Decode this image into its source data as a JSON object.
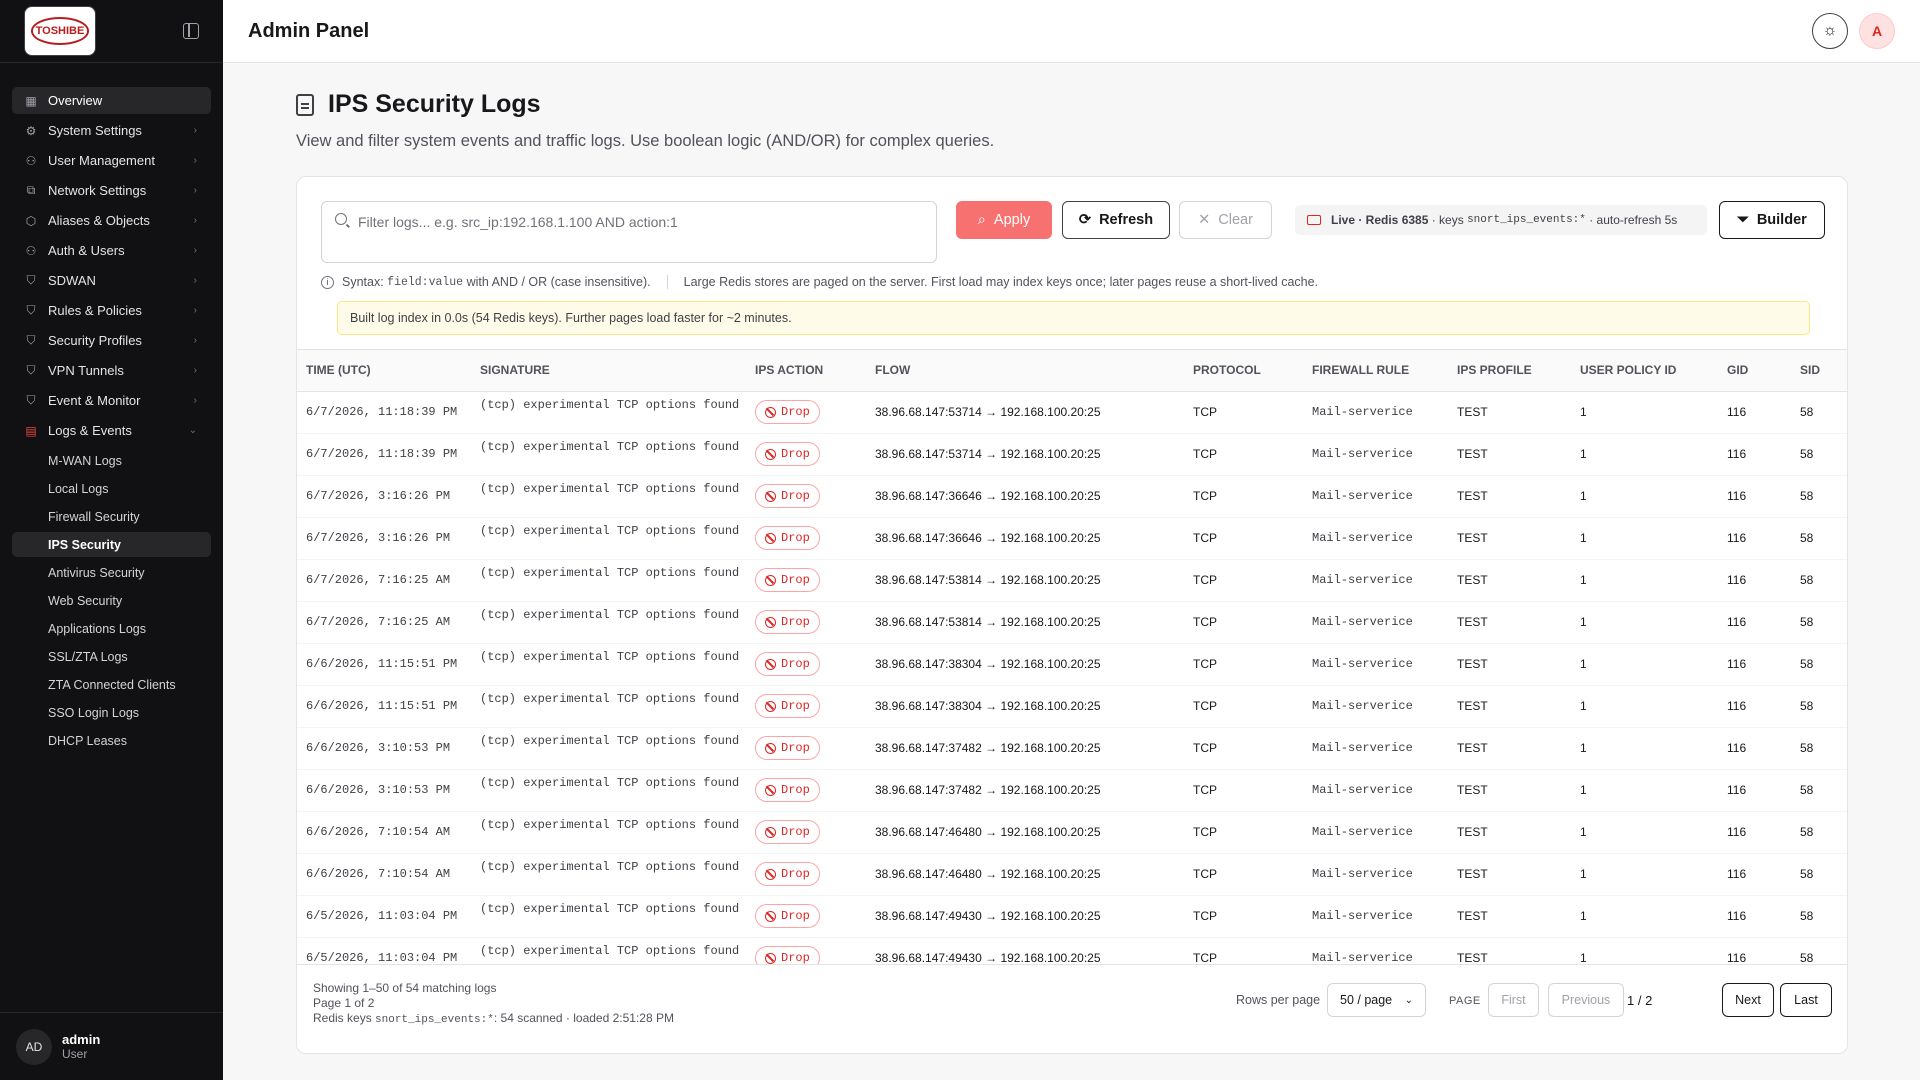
{
  "app": {
    "title": "Admin Panel",
    "logo_text": "TOSHIBE",
    "user": {
      "initials": "AD",
      "name": "admin",
      "role": "User"
    },
    "top_avatar": "A"
  },
  "nav": [
    {
      "label": "Overview",
      "icon": "grid-icon"
    },
    {
      "label": "System Settings",
      "icon": "gear-icon"
    },
    {
      "label": "User Management",
      "icon": "users-icon"
    },
    {
      "label": "Network Settings",
      "icon": "network-icon"
    },
    {
      "label": "Aliases & Objects",
      "icon": "box-icon"
    },
    {
      "label": "Auth & Users",
      "icon": "users-icon"
    },
    {
      "label": "SDWAN",
      "icon": "shield-icon"
    },
    {
      "label": "Rules & Policies",
      "icon": "shield-icon"
    },
    {
      "label": "Security Profiles",
      "icon": "shield-icon"
    },
    {
      "label": "VPN Tunnels",
      "icon": "shield-icon"
    },
    {
      "label": "Event & Monitor",
      "icon": "shield-icon"
    },
    {
      "label": "Logs & Events",
      "icon": "log-icon"
    }
  ],
  "subnav": [
    "M-WAN Logs",
    "Local Logs",
    "Firewall Security",
    "IPS Security",
    "Antivirus Security",
    "Web Security",
    "Applications Logs",
    "SSL/ZTA Logs",
    "ZTA Connected Clients",
    "SSO Login Logs",
    "DHCP Leases"
  ],
  "page": {
    "title": "IPS Security Logs",
    "description": "View and filter system events and traffic logs. Use boolean logic (AND/OR) for complex queries."
  },
  "filter": {
    "placeholder": "Filter logs... e.g. src_ip:192.168.1.100 AND action:1",
    "apply": "Apply",
    "refresh": "Refresh",
    "clear": "Clear",
    "builder": "Builder"
  },
  "live": {
    "label": "Live · Redis 6385",
    "keys_prefix": " · keys ",
    "keys": "snort_ips_events:*",
    "suffix": " · auto-refresh 5s"
  },
  "syntax": {
    "prefix": "Syntax: ",
    "code": "field:value",
    "suffix": " with AND / OR (case insensitive).",
    "note": "Large Redis stores are paged on the server. First load may index keys once; later pages reuse a short-lived cache."
  },
  "notice": "Built log index in 0.0s (54 Redis keys). Further pages load faster for ~2 minutes.",
  "table": {
    "columns": [
      "TIME (UTC)",
      "SIGNATURE",
      "IPS ACTION",
      "FLOW",
      "PROTOCOL",
      "FIREWALL RULE",
      "IPS PROFILE",
      "USER POLICY ID",
      "GID",
      "SID"
    ],
    "rows": [
      [
        "6/7/2026, 11:18:39 PM",
        "(tcp) experimental TCP options found",
        "Drop",
        "38.96.68.147:53714 → 192.168.100.20:25",
        "TCP",
        "Mail-serverice",
        "TEST",
        "1",
        "116",
        "58"
      ],
      [
        "6/7/2026, 11:18:39 PM",
        "(tcp) experimental TCP options found",
        "Drop",
        "38.96.68.147:53714 → 192.168.100.20:25",
        "TCP",
        "Mail-serverice",
        "TEST",
        "1",
        "116",
        "58"
      ],
      [
        "6/7/2026, 3:16:26 PM",
        "(tcp) experimental TCP options found",
        "Drop",
        "38.96.68.147:36646 → 192.168.100.20:25",
        "TCP",
        "Mail-serverice",
        "TEST",
        "1",
        "116",
        "58"
      ],
      [
        "6/7/2026, 3:16:26 PM",
        "(tcp) experimental TCP options found",
        "Drop",
        "38.96.68.147:36646 → 192.168.100.20:25",
        "TCP",
        "Mail-serverice",
        "TEST",
        "1",
        "116",
        "58"
      ],
      [
        "6/7/2026, 7:16:25 AM",
        "(tcp) experimental TCP options found",
        "Drop",
        "38.96.68.147:53814 → 192.168.100.20:25",
        "TCP",
        "Mail-serverice",
        "TEST",
        "1",
        "116",
        "58"
      ],
      [
        "6/7/2026, 7:16:25 AM",
        "(tcp) experimental TCP options found",
        "Drop",
        "38.96.68.147:53814 → 192.168.100.20:25",
        "TCP",
        "Mail-serverice",
        "TEST",
        "1",
        "116",
        "58"
      ],
      [
        "6/6/2026, 11:15:51 PM",
        "(tcp) experimental TCP options found",
        "Drop",
        "38.96.68.147:38304 → 192.168.100.20:25",
        "TCP",
        "Mail-serverice",
        "TEST",
        "1",
        "116",
        "58"
      ],
      [
        "6/6/2026, 11:15:51 PM",
        "(tcp) experimental TCP options found",
        "Drop",
        "38.96.68.147:38304 → 192.168.100.20:25",
        "TCP",
        "Mail-serverice",
        "TEST",
        "1",
        "116",
        "58"
      ],
      [
        "6/6/2026, 3:10:53 PM",
        "(tcp) experimental TCP options found",
        "Drop",
        "38.96.68.147:37482 → 192.168.100.20:25",
        "TCP",
        "Mail-serverice",
        "TEST",
        "1",
        "116",
        "58"
      ],
      [
        "6/6/2026, 3:10:53 PM",
        "(tcp) experimental TCP options found",
        "Drop",
        "38.96.68.147:37482 → 192.168.100.20:25",
        "TCP",
        "Mail-serverice",
        "TEST",
        "1",
        "116",
        "58"
      ],
      [
        "6/6/2026, 7:10:54 AM",
        "(tcp) experimental TCP options found",
        "Drop",
        "38.96.68.147:46480 → 192.168.100.20:25",
        "TCP",
        "Mail-serverice",
        "TEST",
        "1",
        "116",
        "58"
      ],
      [
        "6/6/2026, 7:10:54 AM",
        "(tcp) experimental TCP options found",
        "Drop",
        "38.96.68.147:46480 → 192.168.100.20:25",
        "TCP",
        "Mail-serverice",
        "TEST",
        "1",
        "116",
        "58"
      ],
      [
        "6/5/2026, 11:03:04 PM",
        "(tcp) experimental TCP options found",
        "Drop",
        "38.96.68.147:49430 → 192.168.100.20:25",
        "TCP",
        "Mail-serverice",
        "TEST",
        "1",
        "116",
        "58"
      ],
      [
        "6/5/2026, 11:03:04 PM",
        "(tcp) experimental TCP options found",
        "Drop",
        "38.96.68.147:49430 → 192.168.100.20:25",
        "TCP",
        "Mail-serverice",
        "TEST",
        "1",
        "116",
        "58"
      ]
    ]
  },
  "footer": {
    "showing": "Showing 1–50 of 54 matching logs",
    "page": "Page 1 of 2",
    "keys_prefix": "Redis keys ",
    "keys": "snort_ips_events:*",
    "keys_suffix": ": 54 scanned · loaded 2:51:28 PM",
    "rows_per_page": "Rows per page",
    "rpp_value": "50 / page",
    "page_label": "PAGE",
    "first": "First",
    "previous": "Previous",
    "count": "1 / 2",
    "next": "Next",
    "last": "Last"
  },
  "colors": {
    "accent": "#ef4444",
    "sidebar": "#111113",
    "drop": "#dc2626"
  }
}
